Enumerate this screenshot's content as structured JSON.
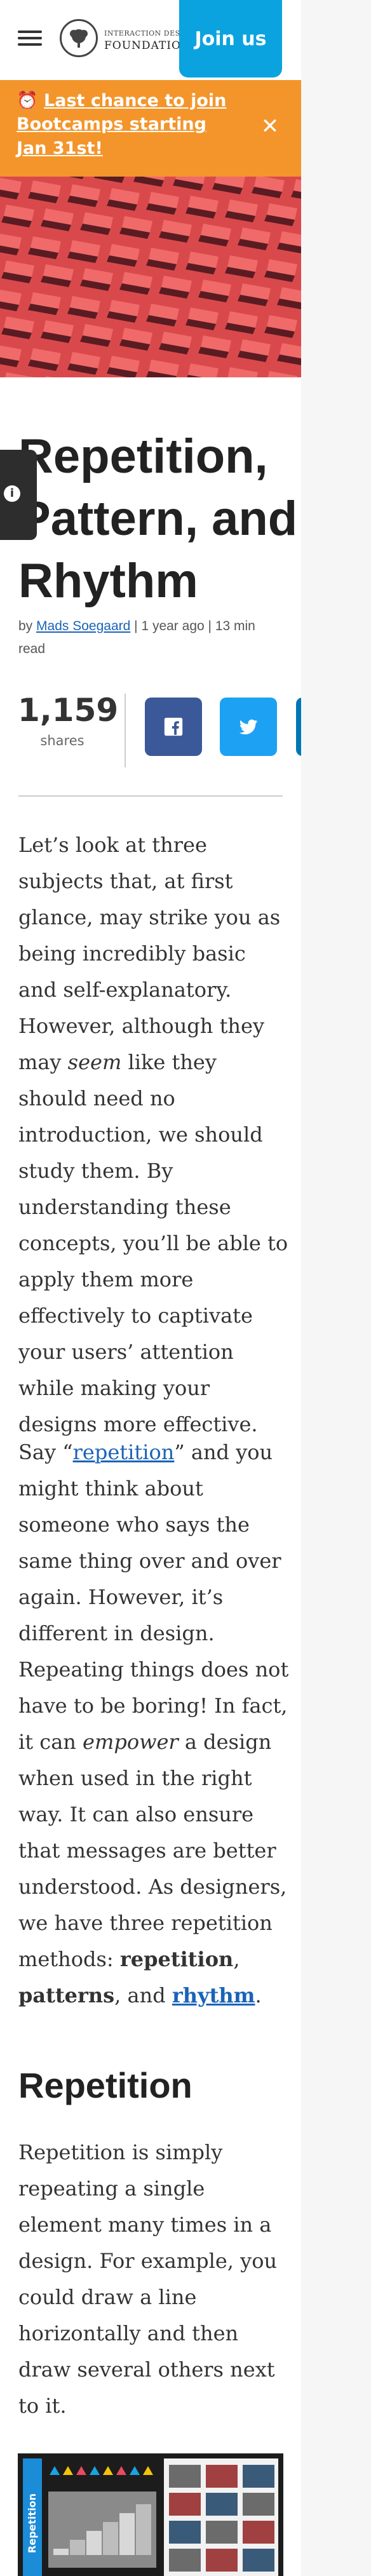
{
  "header": {
    "logo_line1": "INTERACTION DESIGN",
    "logo_line2": "FOUNDATION",
    "join_label": "Join us"
  },
  "banner": {
    "icon": "alarm-clock-icon",
    "text": "Last chance to join Bootcamps starting Jan 31st!",
    "close_icon": "close-icon"
  },
  "article": {
    "title": "Repetition, Pattern, and Rhythm",
    "byline": {
      "prefix": "by",
      "author": "Mads Soegaard",
      "date": "1 year ago",
      "read_time": "13 min read"
    },
    "shares": {
      "count": "1,159",
      "label": "shares"
    },
    "share_buttons": [
      "facebook-icon",
      "twitter-icon",
      "linkedin-icon"
    ],
    "p1": {
      "a": "Let’s look at three subjects that, at first glance, may strike you as being incredibly basic and self-explanatory. However, although they may ",
      "em": "seem",
      "b": " like they should need no introduction, we should study them. By understanding these concepts, you’ll be able to apply them more effectively to captivate your users’ attention while making your designs more effective."
    },
    "p2": {
      "a": "Say “",
      "link": "repetition",
      "b": "” and you might think about someone who says the same thing over and over again. However, it’s different in design. Repeating things does not have to be boring! In fact, it can ",
      "em": "empower",
      "c": " a design when used in the right way. It can also ensure that messages are better understood. As designers, we have three repetition methods: ",
      "s1": "repetition",
      "d": ", ",
      "s2": "patterns",
      "e": ", and ",
      "link2": "rhythm",
      "f": "."
    },
    "h2": "Repetition",
    "p3": "Repetition is simply repeating a single element many times in a design. For example, you could draw a line horizontally and then draw several others next to it.",
    "figure_caption": "Repetition"
  },
  "colors": {
    "join": "#0aa3e0",
    "banner": "#f3952b",
    "facebook": "#3b5998",
    "twitter": "#1da1f2",
    "linkedin": "#0077b5",
    "link": "#1a63b8"
  }
}
